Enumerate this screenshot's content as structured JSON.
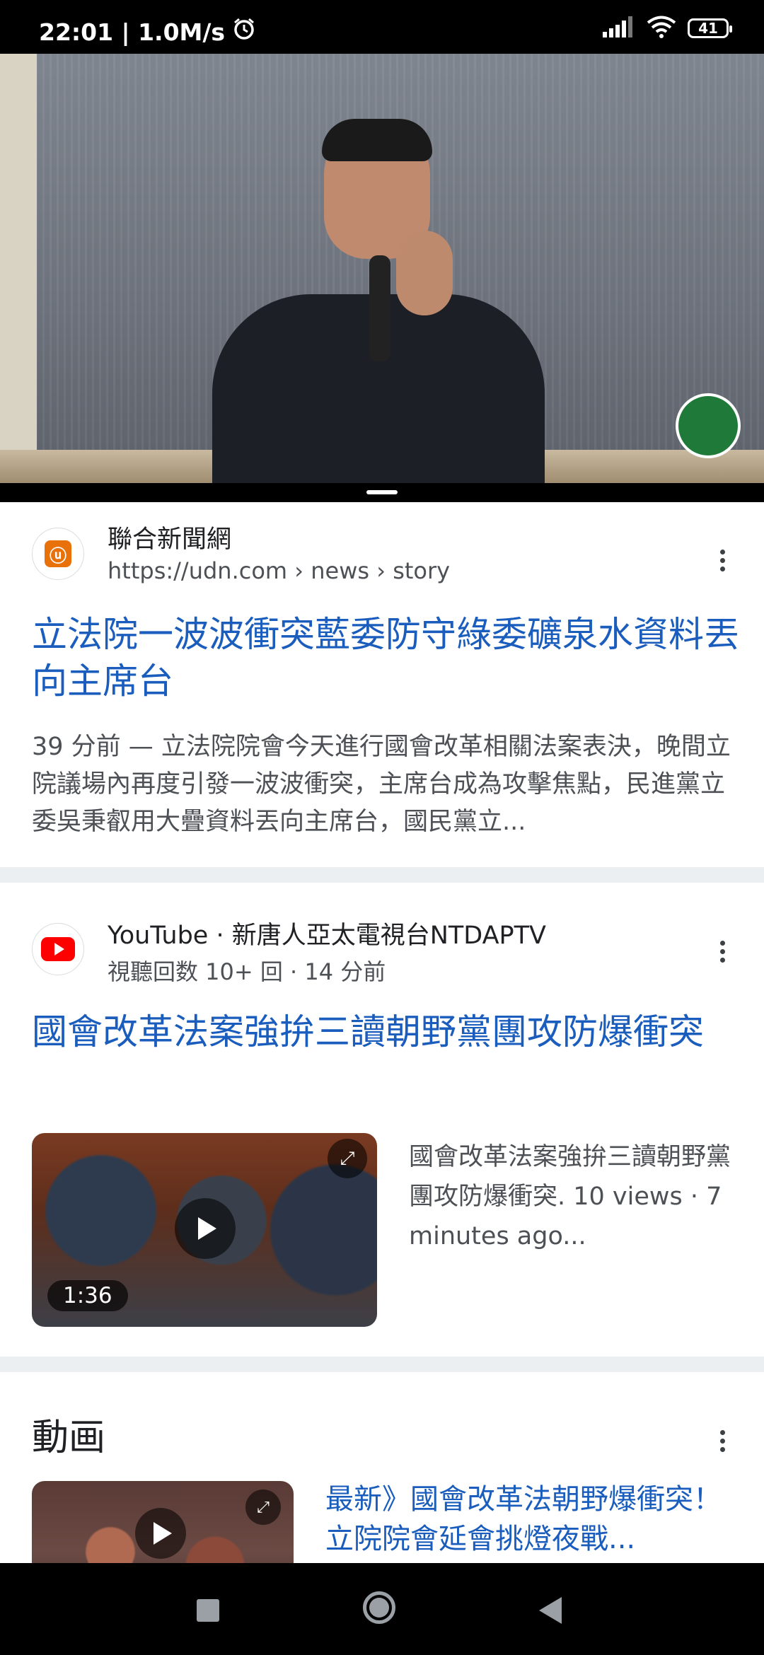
{
  "status_bar": {
    "time_speed": "22:01 | 1.0M/s",
    "alarm_icon": "alarm-clock-icon",
    "battery": "41"
  },
  "video_player": {
    "watermark": "party-emblem"
  },
  "results": [
    {
      "site_name": "聯合新聞網",
      "url": "https://udn.com › news › story",
      "title": "立法院一波波衝突藍委防守綠委礦泉水資料丟向主席台",
      "snippet": "39 分前 — 立法院院會今天進行國會改革相關法案表決，晚間立院議場內再度引發一波波衝突，主席台成為攻擊焦點，民進黨立委吳秉叡用大疊資料丟向主席台，國民黨立..."
    },
    {
      "site_name": "YouTube · 新唐人亞太電視台NTDAPTV",
      "meta": "視聽回数 10+ 回 · 14 分前",
      "title": "國會改革法案強拚三讀朝野黨團攻防爆衝突",
      "duration": "1:36",
      "description": "國會改革法案強拚三讀朝野黨團攻防爆衝突. 10 views · 7 minutes ago..."
    }
  ],
  "videos_section": {
    "title": "動画",
    "first_video_title": "最新》國會改革法朝野爆衝突！ 立院院會延會挑燈夜戰..."
  },
  "nav_bar": {
    "recents": "square-icon",
    "home": "home-circle-icon",
    "back": "back-triangle-icon"
  },
  "colors": {
    "link": "#1a5dbd",
    "snippet": "#4d5156",
    "divider": "#eceff2"
  }
}
